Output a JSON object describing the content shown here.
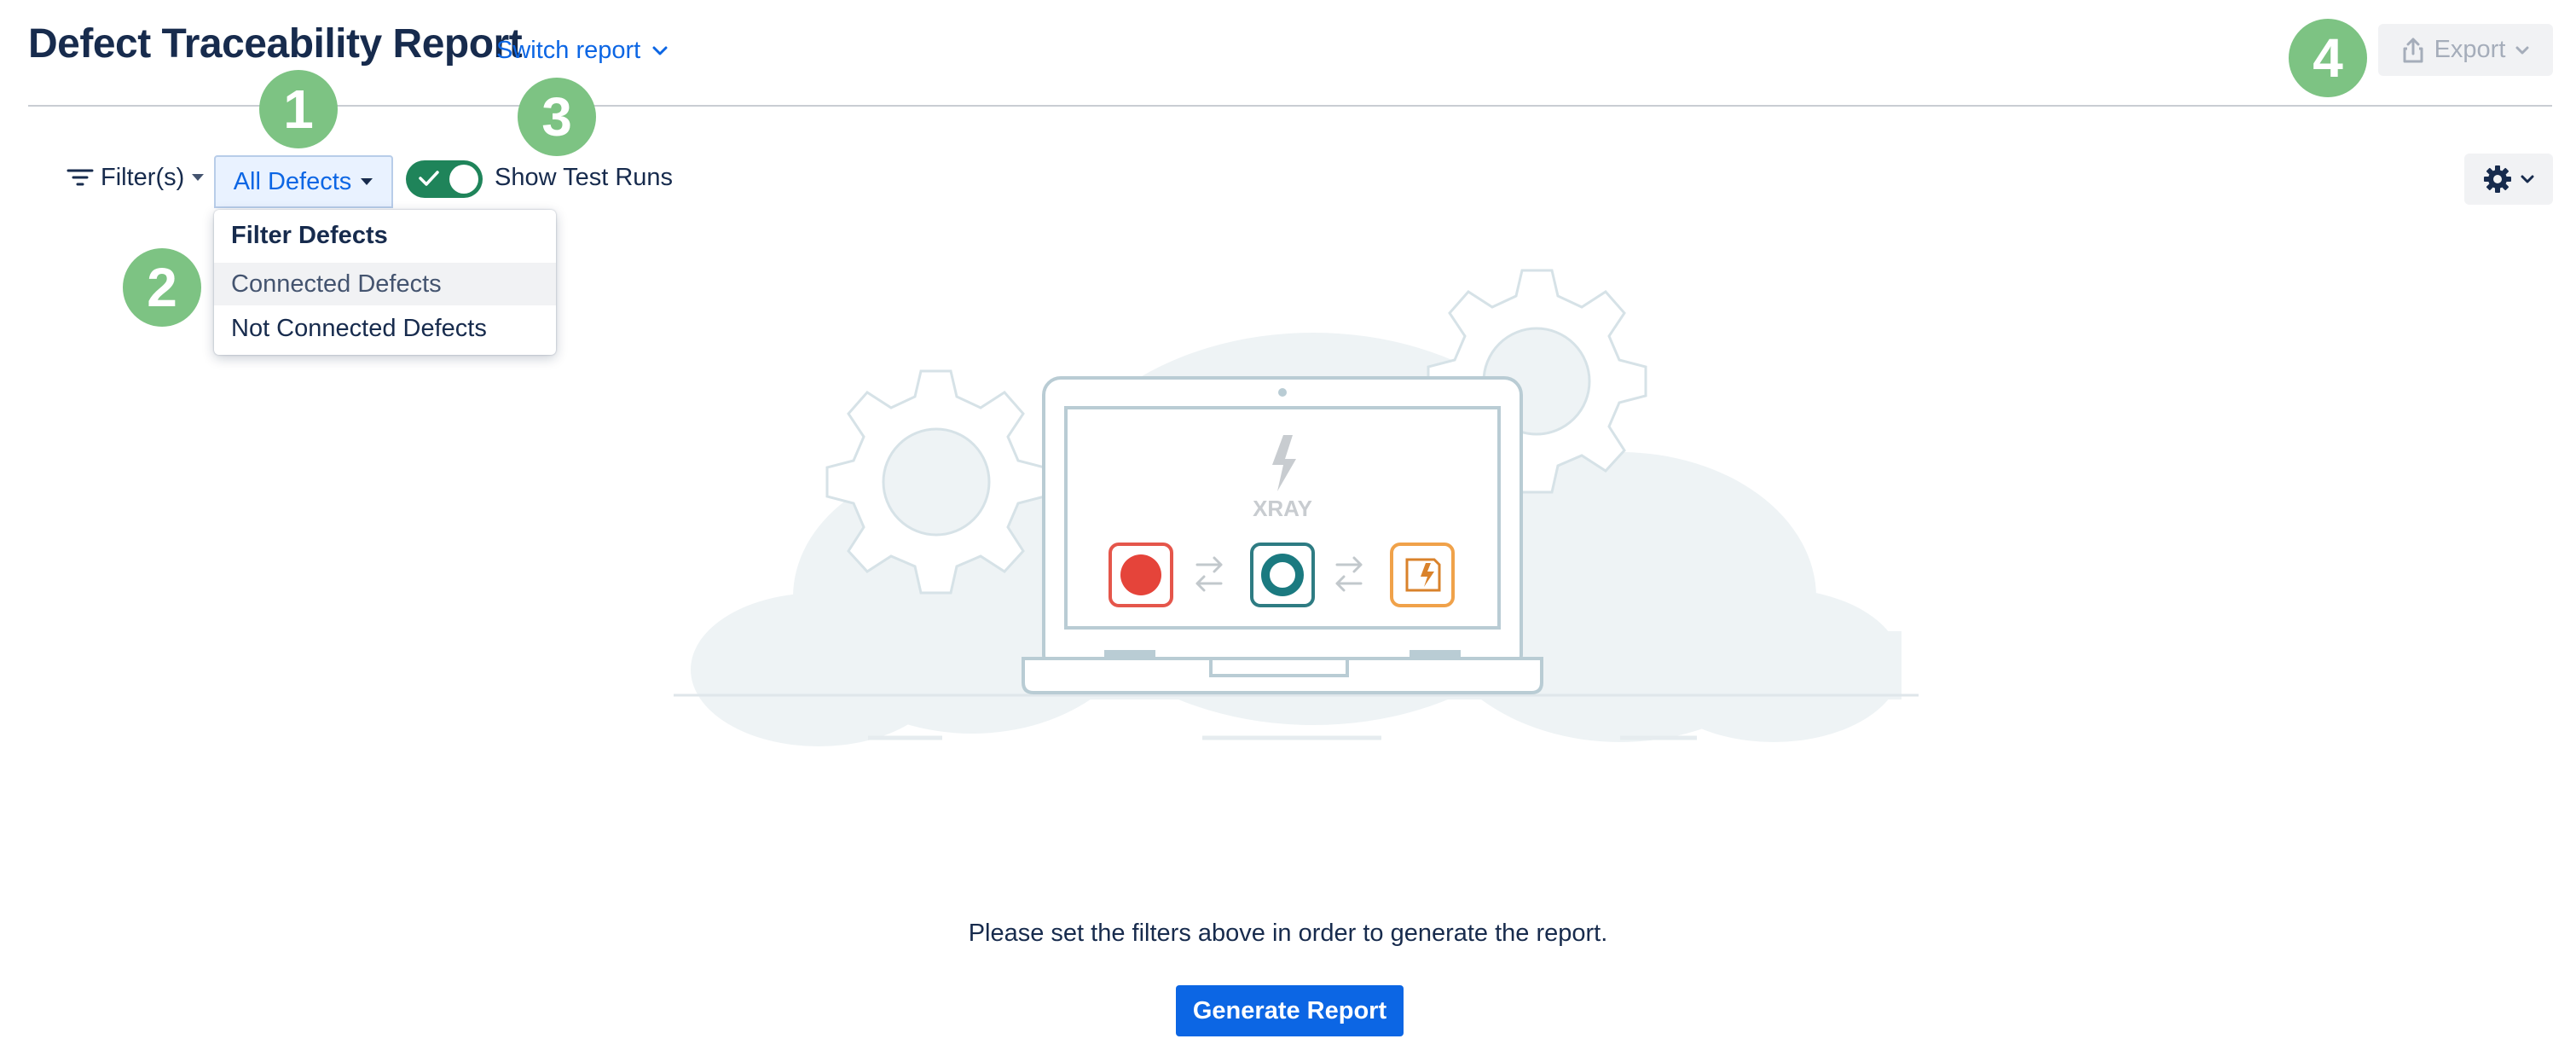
{
  "header": {
    "title": "Defect Traceability Report",
    "switch_report_label": "Switch report",
    "export_label": "Export"
  },
  "toolbar": {
    "filter_label": "Filter(s)",
    "defects_select_label": "All Defects",
    "toggle_label": "Show Test Runs",
    "toggle_on": true
  },
  "dropdown": {
    "heading": "Filter Defects",
    "items": [
      {
        "label": "Connected Defects"
      },
      {
        "label": "Not Connected Defects"
      }
    ]
  },
  "callouts": [
    "1",
    "2",
    "3",
    "4"
  ],
  "illustration": {
    "brand_text": "XRAY"
  },
  "empty_state": {
    "message": "Please set the filters above in order to generate the report.",
    "generate_label": "Generate Report"
  },
  "colors": {
    "link_blue": "#0c66e4",
    "toggle_green": "#1f845a",
    "callout_green": "#7dc383",
    "primary_button": "#0c66e4"
  }
}
